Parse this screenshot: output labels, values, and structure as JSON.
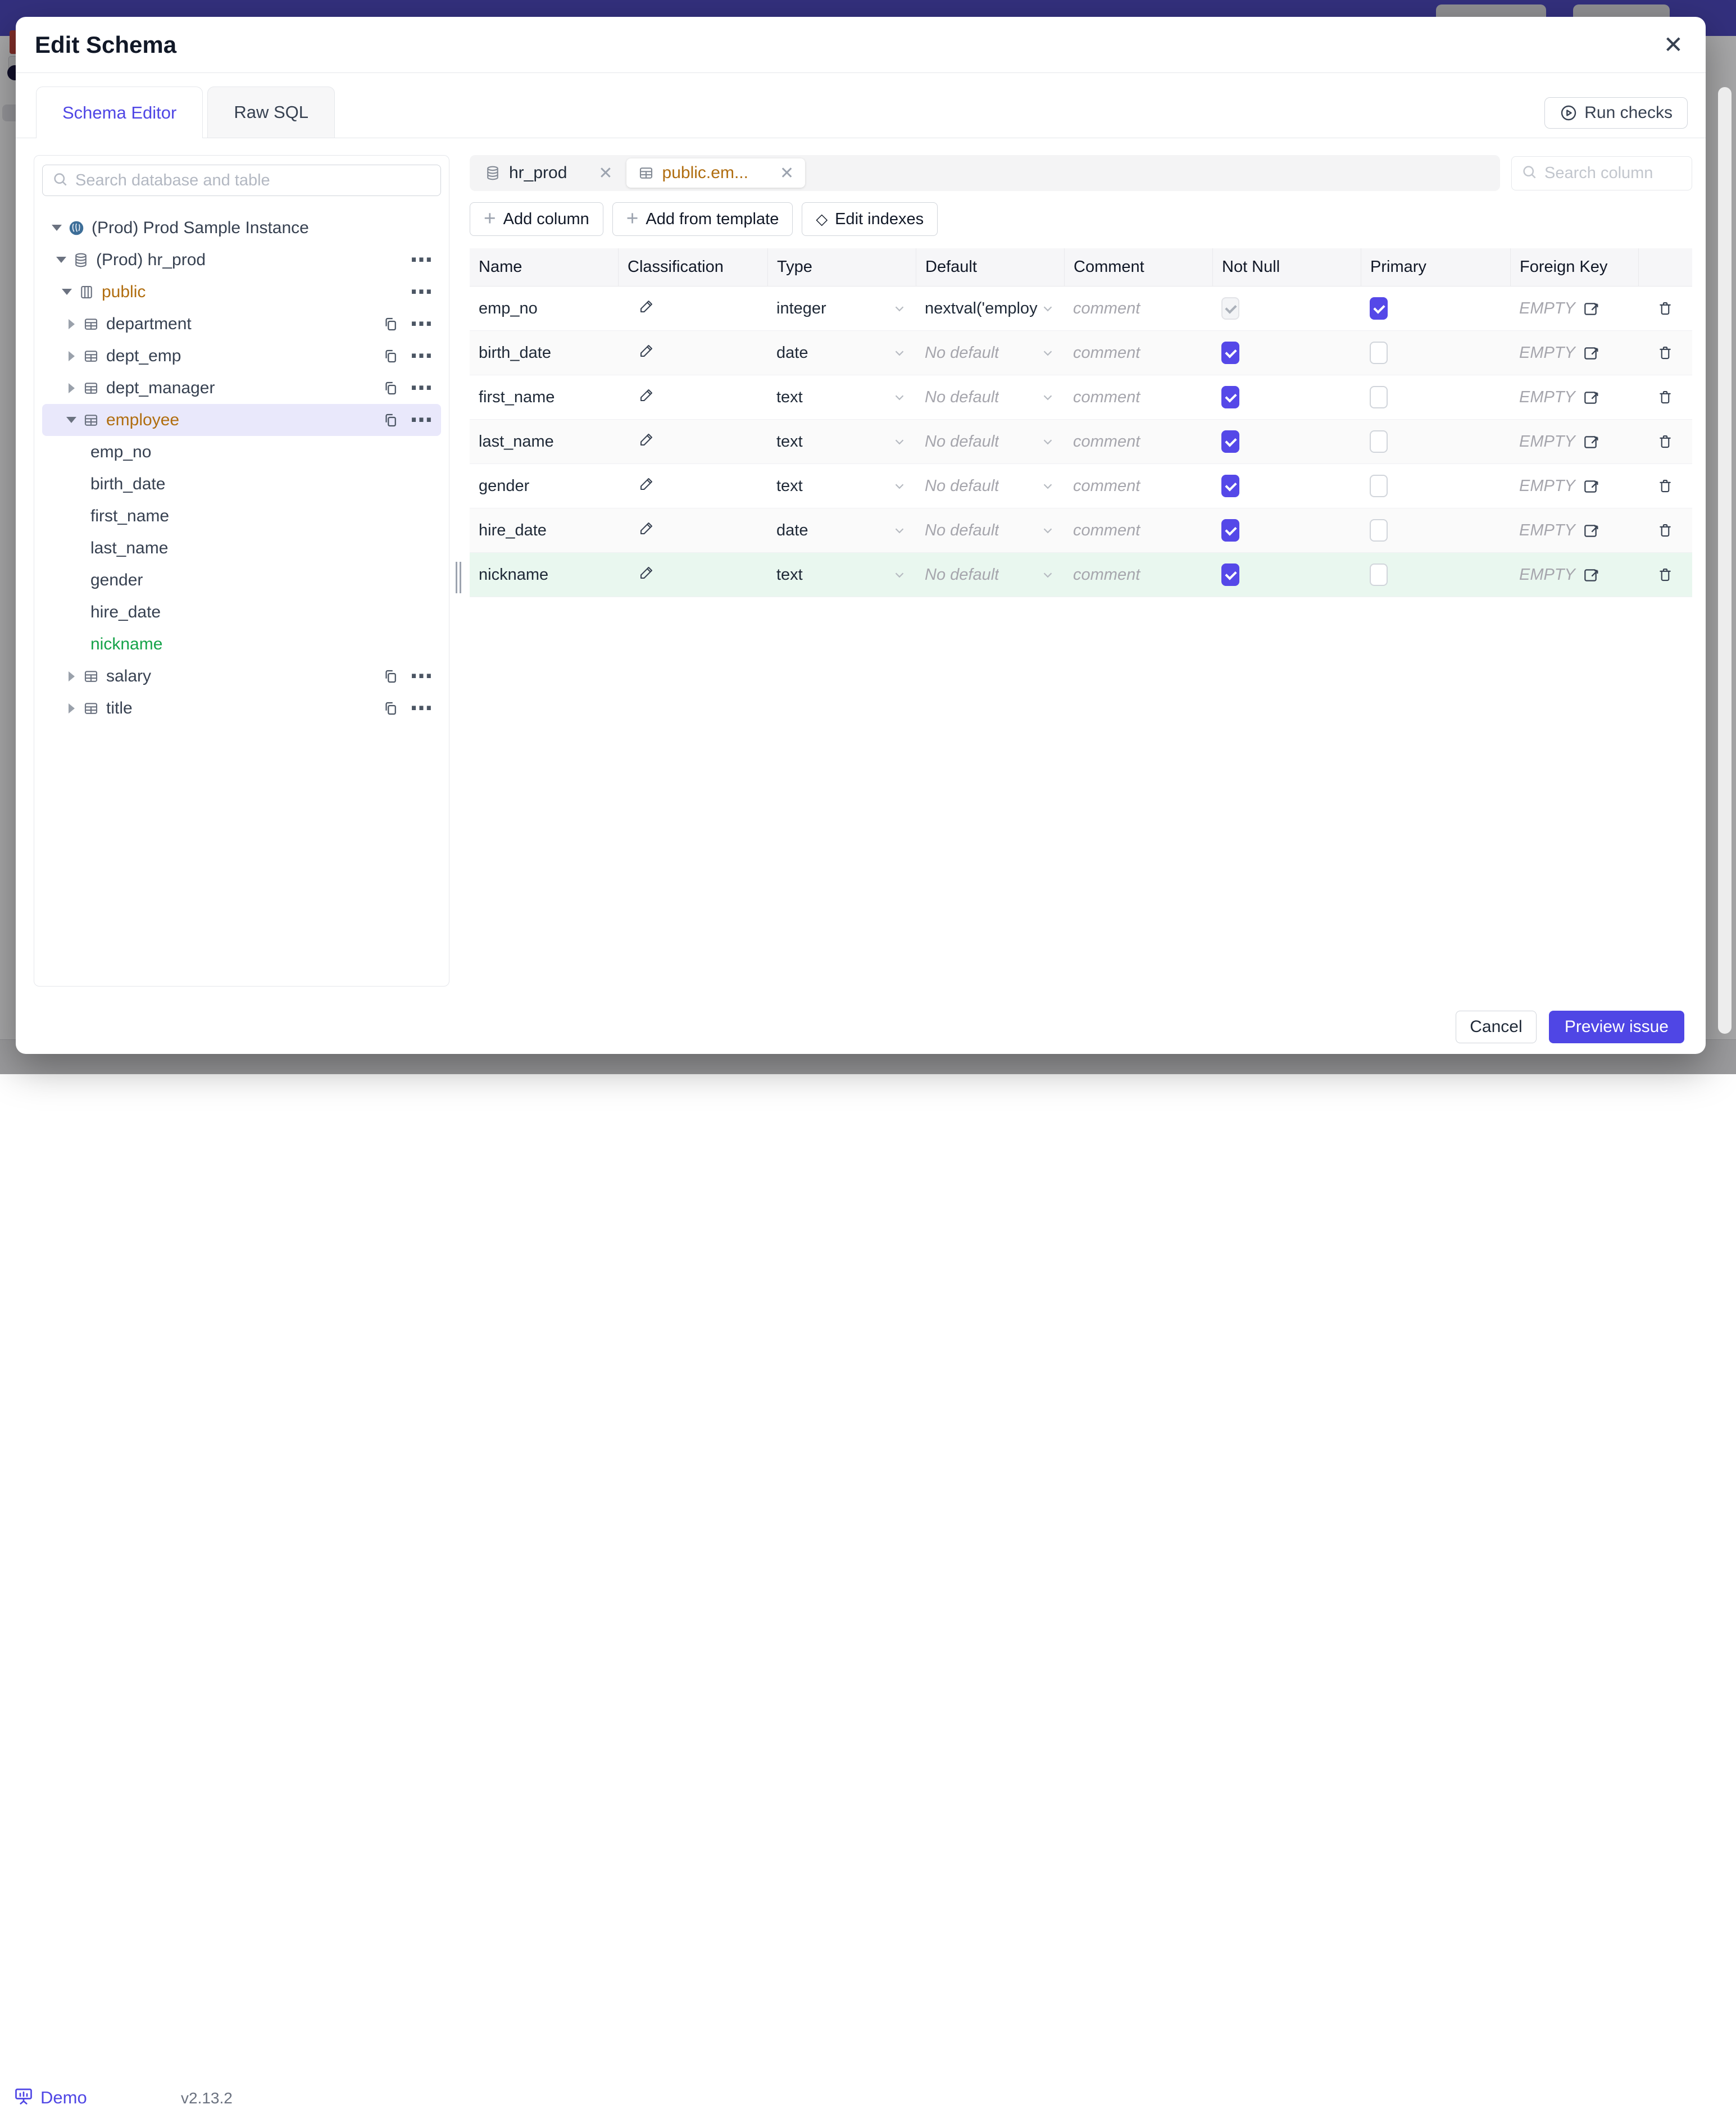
{
  "modal": {
    "title": "Edit Schema",
    "close_icon": "✕",
    "tabs": [
      {
        "label": "Schema Editor",
        "active": true
      },
      {
        "label": "Raw SQL",
        "active": false
      }
    ],
    "run_checks_label": "Run checks"
  },
  "sidebar": {
    "search_placeholder": "Search database and table",
    "tree": [
      {
        "level": 0,
        "caret": "down",
        "icon": "postgres",
        "label": "(Prod) Prod Sample Instance"
      },
      {
        "level": 1,
        "caret": "down",
        "icon": "database",
        "label": "(Prod) hr_prod",
        "more": true
      },
      {
        "level": 2,
        "caret": "down",
        "icon": "schema",
        "label": "public",
        "color": "amber",
        "more": true
      },
      {
        "level": 3,
        "caret": "right",
        "icon": "table",
        "label": "department",
        "copy": true,
        "more": true
      },
      {
        "level": 3,
        "caret": "right",
        "icon": "table",
        "label": "dept_emp",
        "copy": true,
        "more": true
      },
      {
        "level": 3,
        "caret": "right",
        "icon": "table",
        "label": "dept_manager",
        "copy": true,
        "more": true
      },
      {
        "level": 3,
        "caret": "down",
        "icon": "table",
        "label": "employee",
        "color": "amber",
        "selected": true,
        "copy": true,
        "more": true
      },
      {
        "level": 4,
        "label": "emp_no"
      },
      {
        "level": 4,
        "label": "birth_date"
      },
      {
        "level": 4,
        "label": "first_name"
      },
      {
        "level": 4,
        "label": "last_name"
      },
      {
        "level": 4,
        "label": "gender"
      },
      {
        "level": 4,
        "label": "hire_date"
      },
      {
        "level": 4,
        "label": "nickname",
        "color": "green"
      },
      {
        "level": 3,
        "caret": "right",
        "icon": "table",
        "label": "salary",
        "copy": true,
        "more": true
      },
      {
        "level": 3,
        "caret": "right",
        "icon": "table",
        "label": "title",
        "copy": true,
        "more": true
      }
    ]
  },
  "editor": {
    "chips": [
      {
        "label": "hr_prod",
        "icon": "database",
        "active": false,
        "close": "✕"
      },
      {
        "label": "public.em...",
        "icon": "table",
        "active": true,
        "close": "✕"
      }
    ],
    "search_placeholder": "Search column",
    "actions": [
      {
        "label": "Add column",
        "icon": "plus"
      },
      {
        "label": "Add from template",
        "icon": "plus"
      },
      {
        "label": "Edit indexes",
        "icon": "diamond"
      }
    ],
    "table": {
      "headers": [
        "Name",
        "Classification",
        "Type",
        "Default",
        "Comment",
        "Not Null",
        "Primary",
        "Foreign Key"
      ],
      "rows": [
        {
          "name": "emp_no",
          "type": "integer",
          "default": "nextval('employ",
          "default_placeholder": false,
          "comment": "comment",
          "not_null": true,
          "not_null_disabled": true,
          "primary": true,
          "foreign_key": "EMPTY",
          "new": false
        },
        {
          "name": "birth_date",
          "type": "date",
          "default": "No default",
          "default_placeholder": true,
          "comment": "comment",
          "not_null": true,
          "not_null_disabled": false,
          "primary": false,
          "foreign_key": "EMPTY",
          "new": false
        },
        {
          "name": "first_name",
          "type": "text",
          "default": "No default",
          "default_placeholder": true,
          "comment": "comment",
          "not_null": true,
          "not_null_disabled": false,
          "primary": false,
          "foreign_key": "EMPTY",
          "new": false
        },
        {
          "name": "last_name",
          "type": "text",
          "default": "No default",
          "default_placeholder": true,
          "comment": "comment",
          "not_null": true,
          "not_null_disabled": false,
          "primary": false,
          "foreign_key": "EMPTY",
          "new": false
        },
        {
          "name": "gender",
          "type": "text",
          "default": "No default",
          "default_placeholder": true,
          "comment": "comment",
          "not_null": true,
          "not_null_disabled": false,
          "primary": false,
          "foreign_key": "EMPTY",
          "new": false
        },
        {
          "name": "hire_date",
          "type": "date",
          "default": "No default",
          "default_placeholder": true,
          "comment": "comment",
          "not_null": true,
          "not_null_disabled": false,
          "primary": false,
          "foreign_key": "EMPTY",
          "new": false
        },
        {
          "name": "nickname",
          "type": "text",
          "default": "No default",
          "default_placeholder": true,
          "comment": "comment",
          "not_null": true,
          "not_null_disabled": false,
          "primary": false,
          "foreign_key": "EMPTY",
          "new": true
        }
      ]
    }
  },
  "footer": {
    "cancel_label": "Cancel",
    "submit_label": "Preview issue"
  },
  "background": {
    "demo_label": "Demo",
    "version": "v2.13.2"
  },
  "colors": {
    "accent": "#4f46e5",
    "modified_amber": "#b06d0f",
    "created_green": "#16a34a",
    "selected_row": "#e9e8fb",
    "new_row_bg": "#e9f7ef",
    "topbar_navy": "#4a45bc"
  }
}
